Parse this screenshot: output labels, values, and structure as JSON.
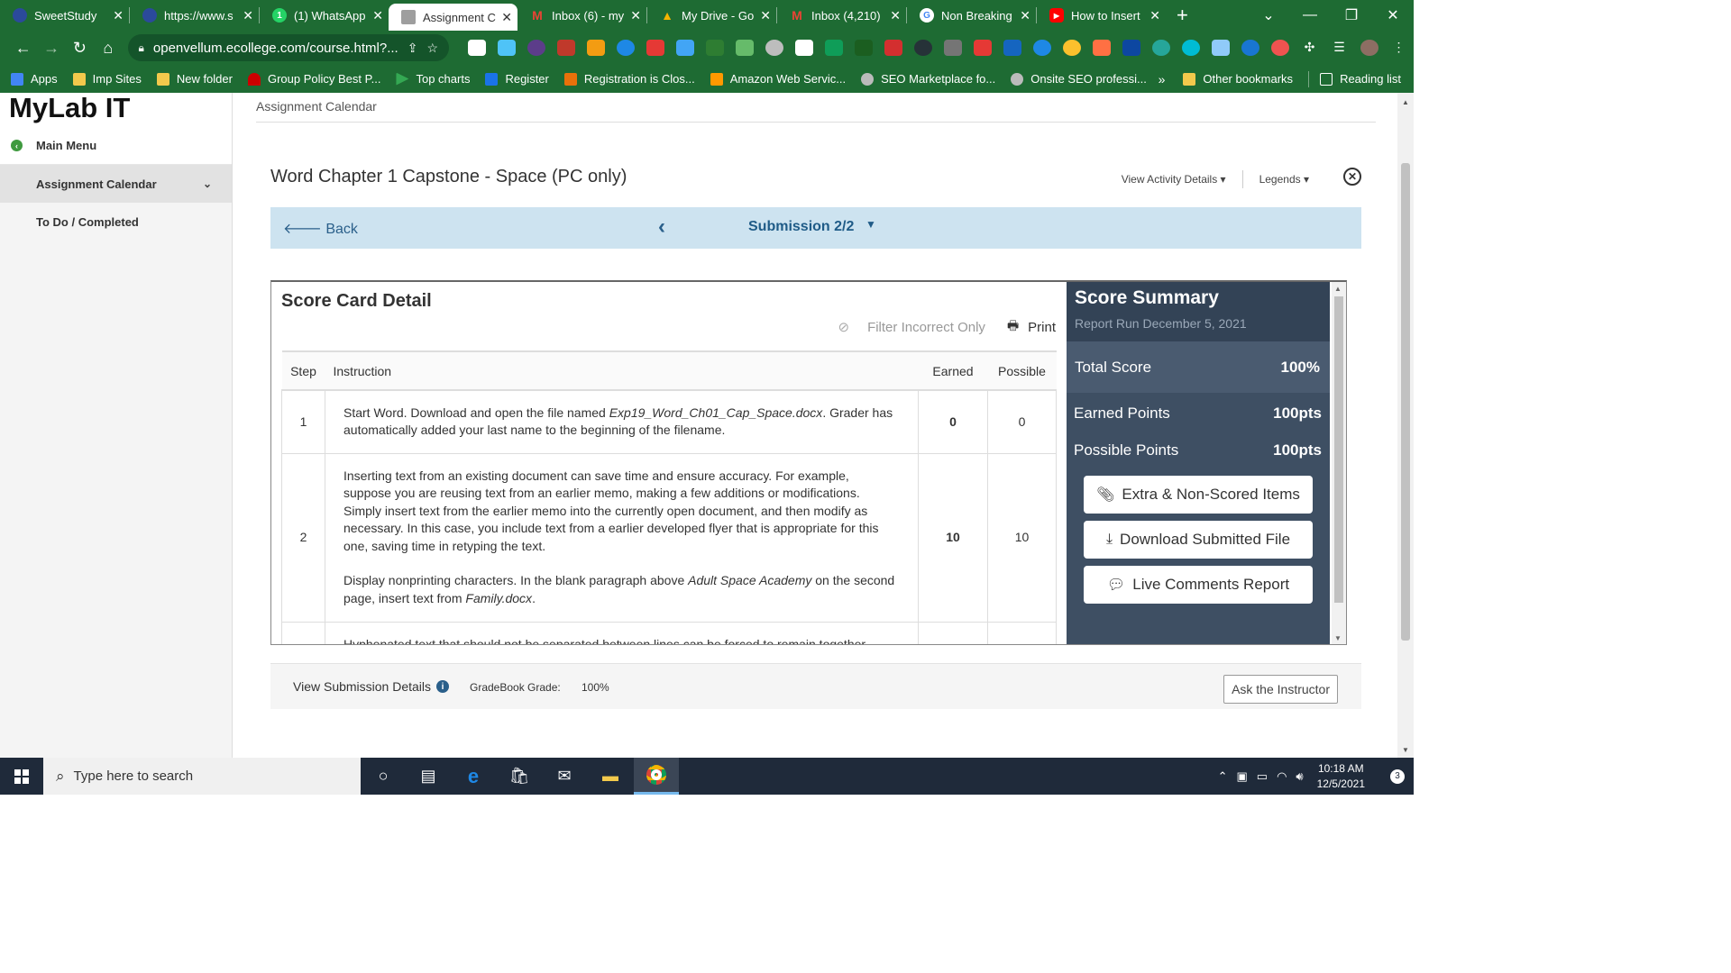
{
  "browser": {
    "tabs": [
      {
        "title": "SweetStudy",
        "color": "#2b4a9b",
        "glyph": ""
      },
      {
        "title": "https://www.s",
        "color": "#2b4a9b",
        "glyph": ""
      },
      {
        "title": "(1) WhatsApp",
        "color": "#25d366",
        "glyph": "1"
      },
      {
        "title": "Assignment C",
        "color": "#9e9e9e",
        "glyph": ""
      },
      {
        "title": "Inbox (6) - my",
        "color": "#d93025",
        "glyph": "M"
      },
      {
        "title": "My Drive - Go",
        "color": "#f4b400",
        "glyph": "▲"
      },
      {
        "title": "Inbox (4,210)",
        "color": "#d93025",
        "glyph": "M"
      },
      {
        "title": "Non Breaking",
        "color": "#4285f4",
        "glyph": "G"
      },
      {
        "title": "How to Insert",
        "color": "#ff0000",
        "glyph": "▶"
      }
    ],
    "url": "openvellum.ecollege.com/course.html?...",
    "bookmarks": [
      {
        "label": "Apps",
        "color": "#4285f4"
      },
      {
        "label": "Imp Sites",
        "color": "#f2c94c"
      },
      {
        "label": "New folder",
        "color": "#f2c94c"
      },
      {
        "label": "Group Policy Best P...",
        "color": "#cc0000"
      },
      {
        "label": "Top charts",
        "color": "#34a853"
      },
      {
        "label": "Register",
        "color": "#1a73e8"
      },
      {
        "label": "Registration is Clos...",
        "color": "#e8710a"
      },
      {
        "label": "Amazon Web Servic...",
        "color": "#ff9900"
      },
      {
        "label": "SEO Marketplace fo...",
        "color": "#bbbbbb"
      },
      {
        "label": "Onsite SEO professi...",
        "color": "#bbbbbb"
      }
    ],
    "bookmarks_overflow": "»",
    "other_bookmarks": "Other bookmarks",
    "reading_list": "Reading list"
  },
  "sidebar": {
    "brand": "MyLab IT",
    "main_menu": "Main Menu",
    "items": [
      {
        "label": "Assignment Calendar"
      },
      {
        "label": "To Do / Completed"
      }
    ]
  },
  "header": {
    "breadcrumb": "Assignment Calendar",
    "title": "Word Chapter 1 Capstone - Space (PC only)",
    "view_activity": "View Activity Details",
    "legends": "Legends"
  },
  "submission_bar": {
    "back": "Back",
    "submission": "Submission 2/2"
  },
  "scorecard": {
    "title": "Score Card Detail",
    "filter": "Filter Incorrect Only",
    "print": "Print",
    "columns": {
      "step": "Step",
      "instruction": "Instruction",
      "earned": "Earned",
      "possible": "Possible"
    },
    "rows": [
      {
        "step": "1",
        "p1_a": "Start Word. Download and open the file named ",
        "p1_em": "Exp19_Word_Ch01_Cap_Space.docx",
        "p1_b": ". Grader has automatically added your last name to the beginning of the filename.",
        "earned": "0",
        "possible": "0"
      },
      {
        "step": "2",
        "p1": "Inserting text from an existing document can save time and ensure accuracy. For example, suppose you are reusing text from an earlier memo, making a few additions or modifications. Simply insert text from the earlier memo into the currently open document, and then modify as necessary. In this case, you include text from a earlier developed flyer that is appropriate for this one, saving time in retyping the text.",
        "p2_a": "Display nonprinting characters. In the blank paragraph above ",
        "p2_em": "Adult Space Academy",
        "p2_b": " on the second page, insert text from ",
        "p2_em2": "Family.docx",
        "p2_c": ".",
        "earned": "10",
        "possible": "10"
      },
      {
        "step": "",
        "p1": "Hyphenated text that should not be separated between lines can be forced to remain together",
        "earned": "",
        "possible": ""
      }
    ]
  },
  "summary": {
    "title": "Score Summary",
    "report_run": "Report Run December 5, 2021",
    "total_label": "Total Score",
    "total_value": "100%",
    "earned_label": "Earned Points",
    "earned_value": "100pts",
    "possible_label": "Possible Points",
    "possible_value": "100pts",
    "buttons": {
      "extra": "Extra & Non-Scored Items",
      "download": "Download Submitted File",
      "comments": "Live Comments Report"
    }
  },
  "footer": {
    "view_details": "View Submission Details",
    "gradebook_label": "GradeBook Grade:",
    "gradebook_value": "100%",
    "ask": "Ask the Instructor"
  },
  "taskbar": {
    "search_placeholder": "Type here to search",
    "time": "10:18 AM",
    "date": "12/5/2021",
    "notifications": "3"
  }
}
